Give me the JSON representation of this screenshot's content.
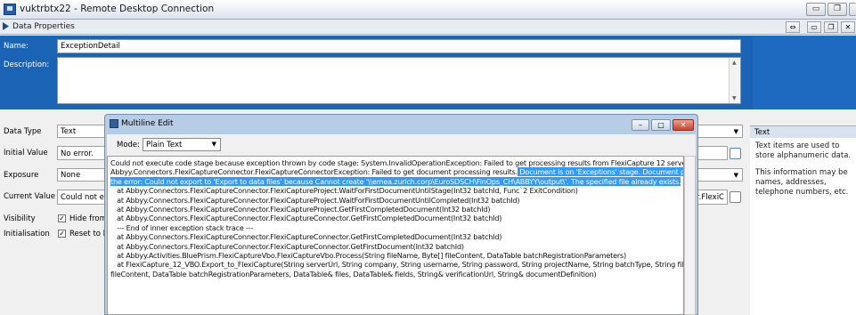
{
  "window": {
    "title": "vuktrbtx22 - Remote Desktop Connection",
    "minimize_glyph": "▭",
    "restore_glyph": "❐",
    "close_glyph": "✕"
  },
  "panel": {
    "title": "Data Properties",
    "button_glyphs": [
      "⇔",
      "▭",
      "❐",
      "✕"
    ]
  },
  "form": {
    "name_label": "Name:",
    "name_value": "ExceptionDetail",
    "description_label": "Description:",
    "data_type_label": "Data Type",
    "data_type_value": "Text",
    "initial_value_label": "Initial Value",
    "initial_value_value": "No error.",
    "exposure_label": "Exposure",
    "exposure_value": "None",
    "current_value_label": "Current Value",
    "current_value_value": "Could not exe",
    "current_value_right": "or.FlexiC",
    "visibility_label": "Visibility",
    "visibility_checkbox": "Hide from o",
    "initialisation_label": "Initialisation",
    "initialisation_checkbox": "Reset to Ini",
    "check_glyph": "✓",
    "dropdown_glyph": "▼"
  },
  "help": {
    "title": "Text",
    "line1": "Text items are used to store alphanumeric data.",
    "line2": "This information may be names, addresses, telephone numbers, etc."
  },
  "dialog": {
    "title": "Multiline Edit",
    "minimize_glyph": "–",
    "maximize_glyph": "□",
    "close_glyph": "✕",
    "mode_label": "Mode:",
    "mode_value": "Plain Text",
    "lines": [
      {
        "text": "Could not execute code stage because exception thrown by code stage: System.InvalidOperationException: Failed to get processing results from FlexiCapture 12 server. --->",
        "highlight": ""
      },
      {
        "text": "Abbyy.Connectors.FlexiCaptureConnector.FlexiCaptureConnectorException: Failed to get document processing results.",
        "highlight": " Document is on 'Exceptions' stage. Document processing failed with"
      },
      {
        "text": "",
        "highlight": "the error: Could not export to 'Export to data files' because Cannot create '\\\\emea.zurich.corp\\EuroSDSCH\\FinOps_CH\\ABBYY\\output\\'. The specified file already exists."
      },
      {
        "text": "   at Abbyy.Connectors.FlexiCaptureConnector.FlexiCaptureProject.WaitForFirstDocumentUntilStage(Int32 batchId, Func`2 ExitCondition)",
        "highlight": ""
      },
      {
        "text": "   at Abbyy.Connectors.FlexiCaptureConnector.FlexiCaptureProject.WaitForFirstDocumentUntilCompleted(Int32 batchId)",
        "highlight": ""
      },
      {
        "text": "   at Abbyy.Connectors.FlexiCaptureConnector.FlexiCaptureProject.GetFirstCompletedDocument(Int32 batchId)",
        "highlight": ""
      },
      {
        "text": "   at Abbyy.Connectors.FlexiCaptureConnector.FlexiCaptureConnector.GetFirstCompletedDocument(Int32 batchId)",
        "highlight": ""
      },
      {
        "text": "   --- End of inner exception stack trace ---",
        "highlight": ""
      },
      {
        "text": "   at Abbyy.Connectors.FlexiCaptureConnector.FlexiCaptureConnector.GetFirstCompletedDocument(Int32 batchId)",
        "highlight": ""
      },
      {
        "text": "   at Abbyy.Connectors.FlexiCaptureConnector.FlexiCaptureConnector.GetFirstDocument(Int32 batchId)",
        "highlight": ""
      },
      {
        "text": "   at Abbyy.Activities.BluePrism.FlexiCaptureVbo.FlexiCaptureVbo.Process(String fileName, Byte[] fileContent, DataTable batchRegistrationParameters)",
        "highlight": ""
      },
      {
        "text": "   at FlexiCapture_12_VBO.Export_to_FlexiCapture(String serverUrl, String company, String username, String password, String projectName, String batchType, String fileName, Byte[]",
        "highlight": ""
      },
      {
        "text": "fileContent, DataTable batchRegistrationParameters, DataTable& files, DataTable& fields, String& verificationUrl, String& documentDefinition)",
        "highlight": ""
      }
    ]
  },
  "colors": {
    "header_blue": "#1a63b5",
    "selection": "#3399ff",
    "dialog_frame": "#b7cde6"
  }
}
